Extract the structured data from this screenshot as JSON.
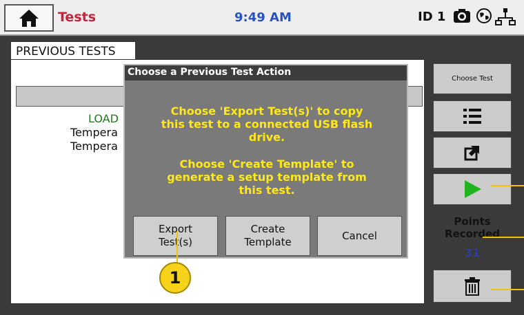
{
  "header": {
    "title": "Tests",
    "time": "9:49 AM",
    "station_id": "ID 1"
  },
  "tab": {
    "label": "PREVIOUS TESTS"
  },
  "panel": {
    "rows": [
      "LOAD",
      "Tempera",
      "Tempera"
    ]
  },
  "sidebar": {
    "choose_test_label": "Choose Test",
    "points_label_line1": "Points",
    "points_label_line2": "Recorded",
    "points_value": "31"
  },
  "modal": {
    "title": "Choose a Previous Test Action",
    "message_line1": "Choose 'Export Test(s)' to copy",
    "message_line2": "this test to a connected USB flash",
    "message_line3": "drive.",
    "message_line4": "Choose 'Create Template' to",
    "message_line5": "generate a setup template from",
    "message_line6": "this test.",
    "buttons": {
      "export_line1": "Export",
      "export_line2": "Test(s)",
      "template_line1": "Create",
      "template_line2": "Template",
      "cancel": "Cancel"
    }
  },
  "callout": {
    "number": "1"
  },
  "colors": {
    "title_red": "#c6243a",
    "time_blue": "#2a52be",
    "dialog_text_yellow": "#ffe81a",
    "callout_yellow": "#f6d21b",
    "play_green": "#21b421"
  },
  "icons": [
    "home-icon",
    "camera-icon",
    "globe-icon",
    "network-icon",
    "list-icon",
    "export-icon",
    "play-icon",
    "trash-icon"
  ]
}
